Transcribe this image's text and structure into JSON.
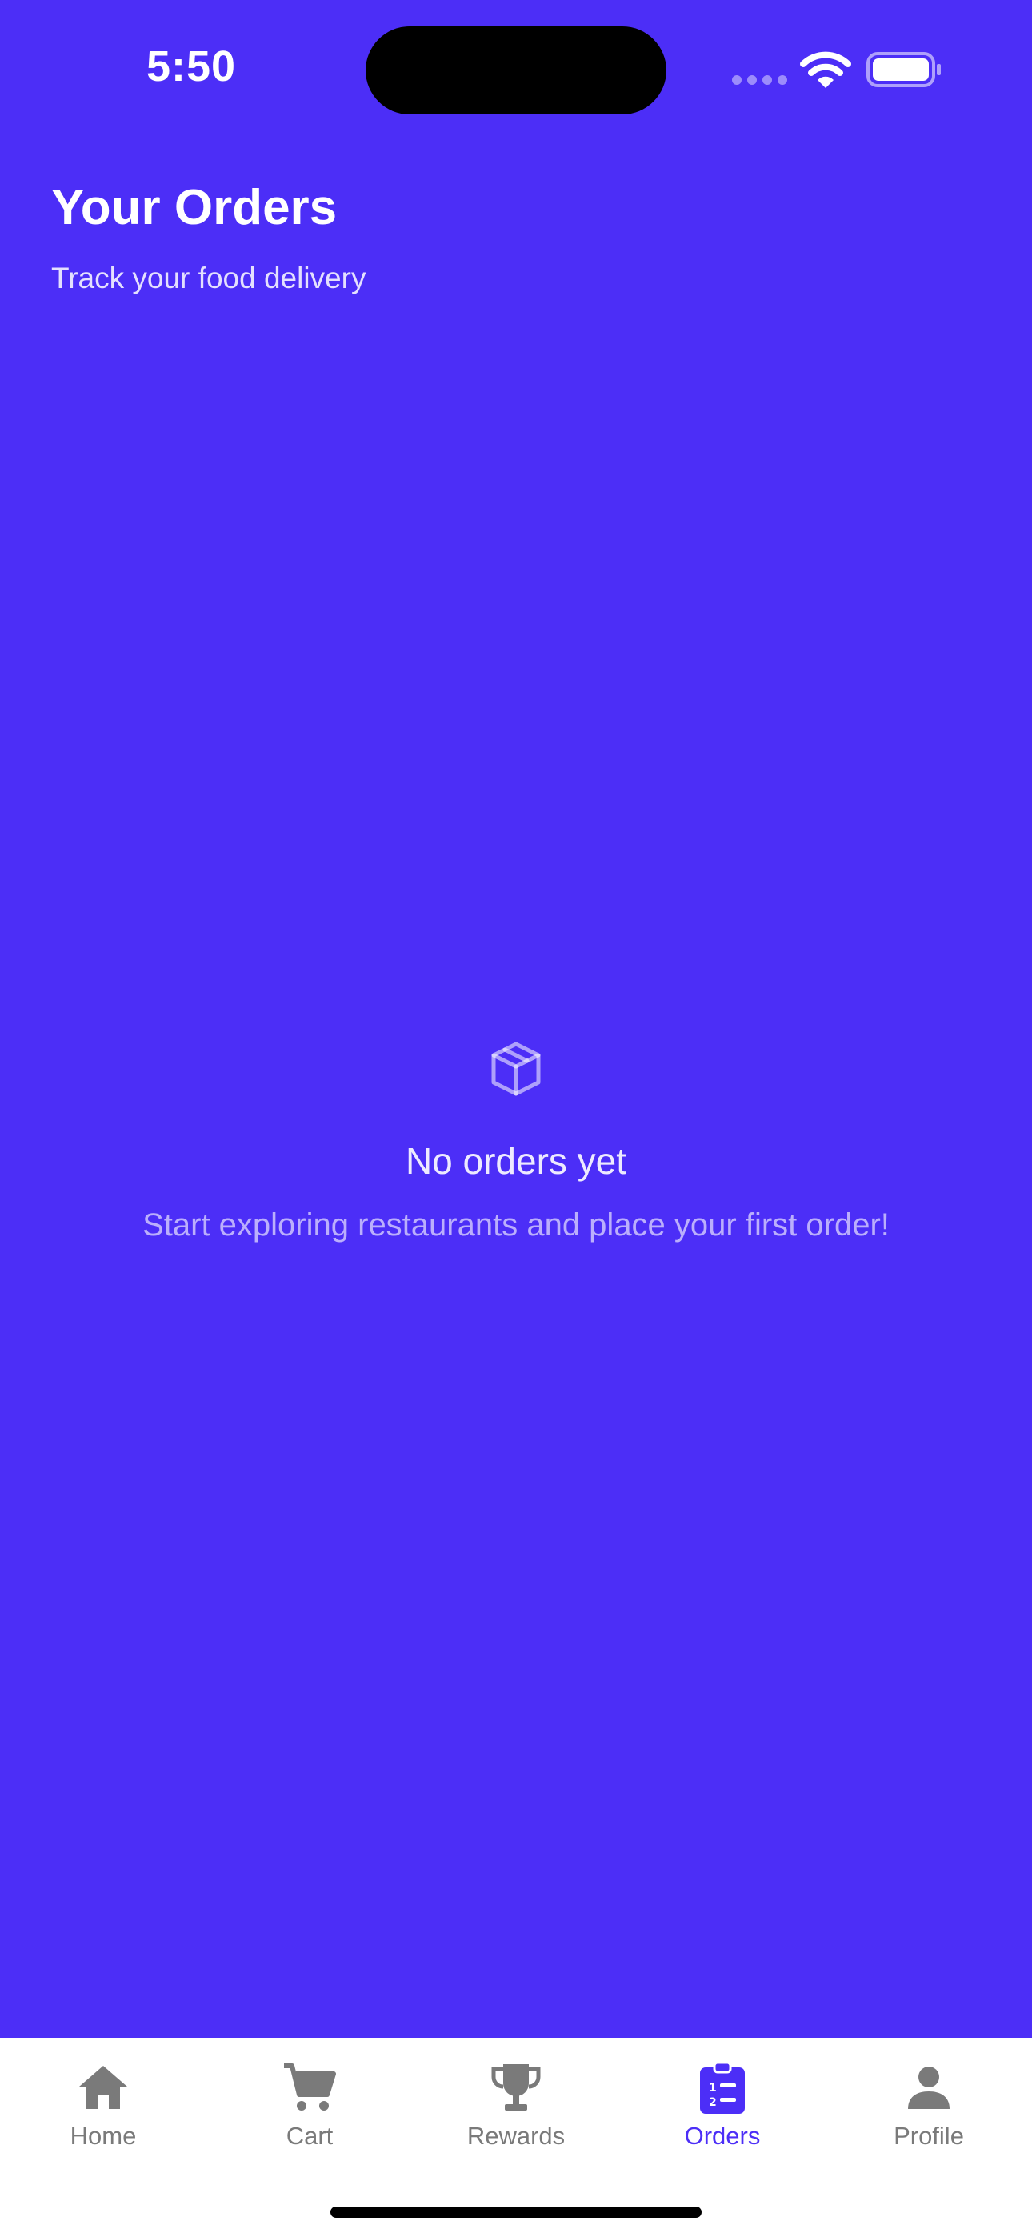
{
  "status_bar": {
    "time": "5:50"
  },
  "header": {
    "title": "Your Orders",
    "subtitle": "Track your food delivery"
  },
  "empty_state": {
    "icon": "package-icon",
    "title": "No orders yet",
    "message": "Start exploring restaurants and place your first order!"
  },
  "tab_bar": {
    "active_tab": "Orders",
    "items": [
      {
        "label": "Home",
        "icon": "home-icon"
      },
      {
        "label": "Cart",
        "icon": "cart-icon"
      },
      {
        "label": "Rewards",
        "icon": "trophy-icon"
      },
      {
        "label": "Orders",
        "icon": "orders-clipboard-icon"
      },
      {
        "label": "Profile",
        "icon": "person-icon"
      }
    ]
  },
  "colors": {
    "background": "#4C2EF7",
    "accent": "#4C2EF7",
    "tab_inactive": "#7A7A7A",
    "tab_bar_background": "#FFFFFF"
  }
}
